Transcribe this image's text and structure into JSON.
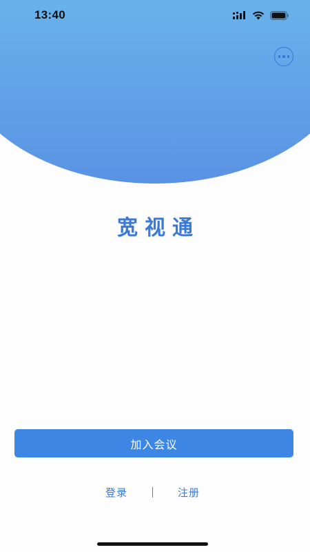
{
  "status_bar": {
    "time": "13:40",
    "icons": [
      "cellular-signal-icon",
      "wifi-icon",
      "battery-icon"
    ]
  },
  "header": {
    "more_icon": "more-options-icon"
  },
  "app": {
    "title": "宽视通"
  },
  "actions": {
    "join_meeting": "加入会议",
    "login": "登录",
    "register": "注册"
  },
  "colors": {
    "accent": "#3d86e4",
    "title": "#3b79d6",
    "gradient_top": "#79dcf5",
    "gradient_bottom": "#5a92e3"
  }
}
